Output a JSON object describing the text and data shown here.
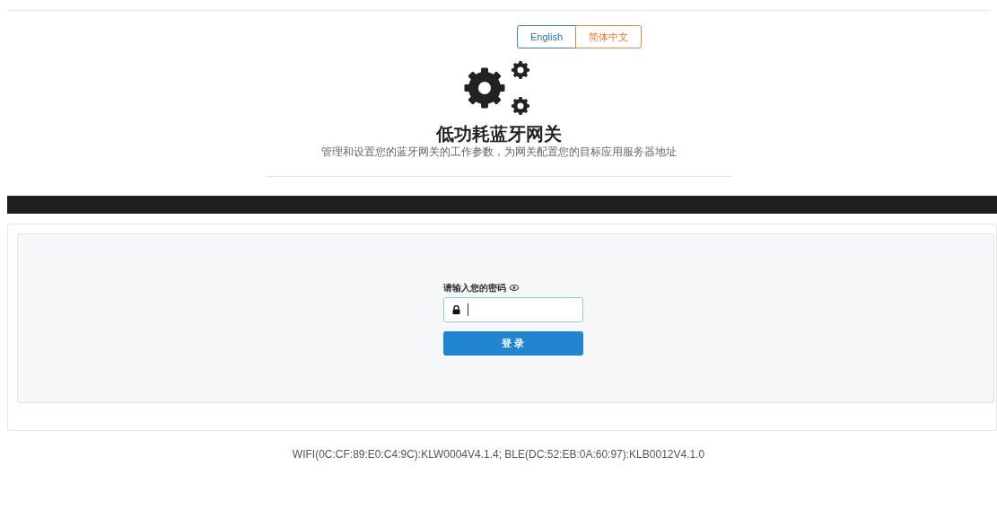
{
  "languages": [
    {
      "label": "English",
      "selected": false
    },
    {
      "label": "简体中文",
      "selected": true
    }
  ],
  "header": {
    "title": "低功耗蓝牙网关",
    "subtitle": "管理和设置您的蓝牙网关的工作参数，为网关配置您的目标应用服务器地址"
  },
  "login": {
    "label": "请输入您的密码",
    "button": "登 录"
  },
  "footer": "WIFI(0C:CF:89:E0:C4:9C):KLW0004V4.1.4; BLE(DC:52:EB:0A:60:97):KLB0012V4.1.0"
}
